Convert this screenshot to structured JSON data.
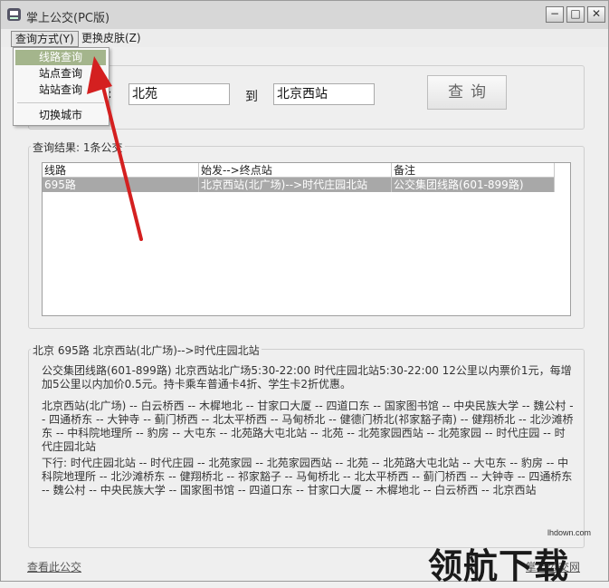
{
  "window": {
    "title": "掌上公交(PC版)",
    "buttons": {
      "minimize": "−",
      "maximize": "□",
      "close": "✕"
    }
  },
  "menubar": {
    "query_mode": "查询方式(Y)",
    "skin": "更换皮肤(Z)"
  },
  "dropdown": {
    "items": [
      {
        "label": "线路查询",
        "selected": true
      },
      {
        "label": "站点查询",
        "selected": false
      },
      {
        "label": "站站查询",
        "selected": false
      },
      {
        "label": "切换城市",
        "selected": false
      }
    ]
  },
  "search": {
    "colon": ":",
    "from_value": "北苑",
    "to_label": "到",
    "to_value": "北京西站",
    "button_label": "查询"
  },
  "results": {
    "legend": "查询结果: 1条公交",
    "columns": [
      "线路",
      "始发-->终点站",
      "备注"
    ],
    "rows": [
      [
        "695路",
        "北京西站(北广场)-->时代庄园北站",
        "公交集团线路(601-899路)"
      ]
    ]
  },
  "detail": {
    "legend": "北京 695路       北京西站(北广场)-->时代庄园北站",
    "price": "公交集团线路(601-899路)       北京西站北广场5:30-22:00 时代庄园北站5:30-22:00       12公里以内票价1元，每增加5公里以内加价0.5元。持卡乘车普通卡4折、学生卡2折优惠。",
    "up": "北京西站(北广场) -- 白云桥西 -- 木樨地北 -- 甘家口大厦 -- 四道口东 -- 国家图书馆 -- 中央民族大学 -- 魏公村 -- 四通桥东 -- 大钟寺 -- 蓟门桥西 -- 北太平桥西 -- 马甸桥北 -- 健德门桥北(祁家豁子南) -- 健翔桥北 -- 北沙滩桥东 -- 中科院地理所 -- 豹房 -- 大屯东 -- 北苑路大屯北站 -- 北苑 -- 北苑家园西站 -- 北苑家园 -- 时代庄园 -- 时代庄园北站",
    "down": "下行:     时代庄园北站 -- 时代庄园 -- 北苑家园 -- 北苑家园西站 -- 北苑 -- 北苑路大屯北站 -- 大屯东 -- 豹房 -- 中科院地理所 -- 北沙滩桥东 -- 健翔桥北 -- 祁家豁子 -- 马甸桥北 -- 北太平桥西 -- 蓟门桥西 -- 大钟寺 -- 四通桥东 -- 魏公村 -- 中央民族大学 -- 国家图书馆 -- 四道口东 -- 甘家口大厦 -- 木樨地北 -- 白云桥西 -- 北京西站"
  },
  "footer": {
    "view_link": "查看此公交",
    "brand_link": "掌上公交网"
  },
  "watermark": {
    "url": "lhdown.com",
    "text": "领航下载"
  },
  "colors": {
    "selection": "#a8a8a8",
    "menu_highlight": "#a4b58c",
    "arrow": "#d42020"
  }
}
